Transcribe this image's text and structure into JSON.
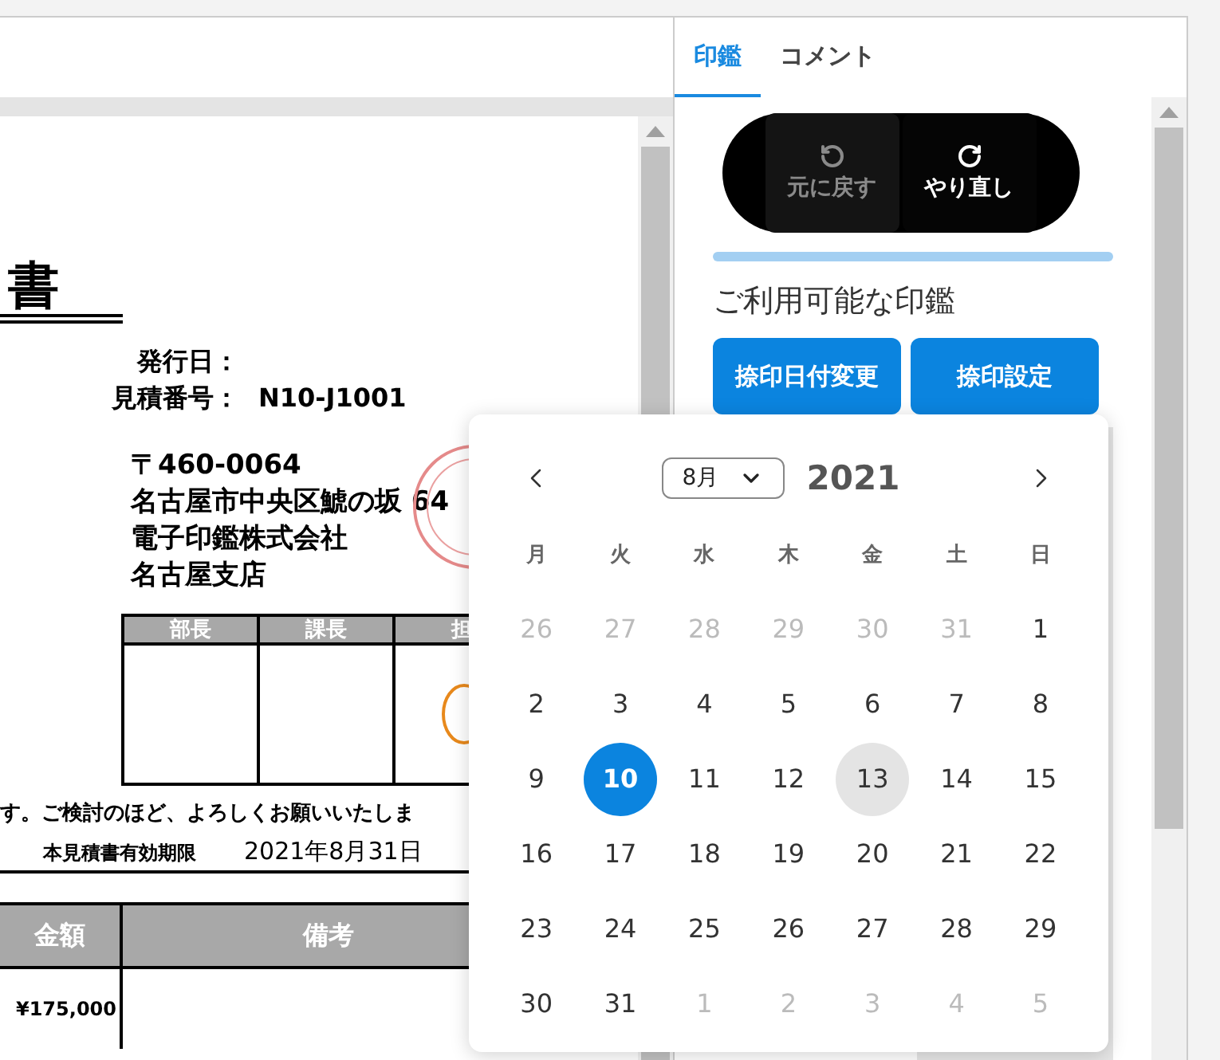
{
  "document": {
    "title": "書",
    "issue_date_label": "発行日：",
    "estimate_label": "見積番号：",
    "estimate_number": "N10-J1001",
    "address": [
      "〒460-0064",
      "名古屋市中央区鯱の坂 64",
      "電子印鑑株式会社",
      "名古屋支店"
    ],
    "approvals": [
      "部長",
      "課長",
      "担"
    ],
    "note": "す。ご検討のほど、よろしくお願いいたしま",
    "validity_label": "本見積書有効期限",
    "validity_date": "2021年8月31日",
    "columns": [
      "金額",
      "備考"
    ],
    "amount": "¥175,000"
  },
  "panel": {
    "tabs": [
      {
        "label": "印鑑",
        "selected": true
      },
      {
        "label": "コメント",
        "selected": false
      }
    ],
    "undo": {
      "label": "元に戻す",
      "disabled": true
    },
    "redo": {
      "label": "やり直し",
      "disabled": false
    },
    "heading": "ご利用可能な印鑑",
    "buttons": [
      "捺印日付変更",
      "捺印設定"
    ]
  },
  "calendar": {
    "month": "8月",
    "year": "2021",
    "weekdays": [
      "月",
      "火",
      "水",
      "木",
      "金",
      "土",
      "日"
    ],
    "weeks": [
      [
        {
          "day": "26",
          "outside": true,
          "selected": false,
          "highlighted": false
        },
        {
          "day": "27",
          "outside": true,
          "selected": false,
          "highlighted": false
        },
        {
          "day": "28",
          "outside": true,
          "selected": false,
          "highlighted": false
        },
        {
          "day": "29",
          "outside": true,
          "selected": false,
          "highlighted": false
        },
        {
          "day": "30",
          "outside": true,
          "selected": false,
          "highlighted": false
        },
        {
          "day": "31",
          "outside": true,
          "selected": false,
          "highlighted": false
        },
        {
          "day": "1",
          "outside": false,
          "selected": false,
          "highlighted": false
        }
      ],
      [
        {
          "day": "2",
          "outside": false,
          "selected": false,
          "highlighted": false
        },
        {
          "day": "3",
          "outside": false,
          "selected": false,
          "highlighted": false
        },
        {
          "day": "4",
          "outside": false,
          "selected": false,
          "highlighted": false
        },
        {
          "day": "5",
          "outside": false,
          "selected": false,
          "highlighted": false
        },
        {
          "day": "6",
          "outside": false,
          "selected": false,
          "highlighted": false
        },
        {
          "day": "7",
          "outside": false,
          "selected": false,
          "highlighted": false
        },
        {
          "day": "8",
          "outside": false,
          "selected": false,
          "highlighted": false
        }
      ],
      [
        {
          "day": "9",
          "outside": false,
          "selected": false,
          "highlighted": false
        },
        {
          "day": "10",
          "outside": false,
          "selected": true,
          "highlighted": false
        },
        {
          "day": "11",
          "outside": false,
          "selected": false,
          "highlighted": false
        },
        {
          "day": "12",
          "outside": false,
          "selected": false,
          "highlighted": false
        },
        {
          "day": "13",
          "outside": false,
          "selected": false,
          "highlighted": true
        },
        {
          "day": "14",
          "outside": false,
          "selected": false,
          "highlighted": false
        },
        {
          "day": "15",
          "outside": false,
          "selected": false,
          "highlighted": false
        }
      ],
      [
        {
          "day": "16",
          "outside": false,
          "selected": false,
          "highlighted": false
        },
        {
          "day": "17",
          "outside": false,
          "selected": false,
          "highlighted": false
        },
        {
          "day": "18",
          "outside": false,
          "selected": false,
          "highlighted": false
        },
        {
          "day": "19",
          "outside": false,
          "selected": false,
          "highlighted": false
        },
        {
          "day": "20",
          "outside": false,
          "selected": false,
          "highlighted": false
        },
        {
          "day": "21",
          "outside": false,
          "selected": false,
          "highlighted": false
        },
        {
          "day": "22",
          "outside": false,
          "selected": false,
          "highlighted": false
        }
      ],
      [
        {
          "day": "23",
          "outside": false,
          "selected": false,
          "highlighted": false
        },
        {
          "day": "24",
          "outside": false,
          "selected": false,
          "highlighted": false
        },
        {
          "day": "25",
          "outside": false,
          "selected": false,
          "highlighted": false
        },
        {
          "day": "26",
          "outside": false,
          "selected": false,
          "highlighted": false
        },
        {
          "day": "27",
          "outside": false,
          "selected": false,
          "highlighted": false
        },
        {
          "day": "28",
          "outside": false,
          "selected": false,
          "highlighted": false
        },
        {
          "day": "29",
          "outside": false,
          "selected": false,
          "highlighted": false
        }
      ],
      [
        {
          "day": "30",
          "outside": false,
          "selected": false,
          "highlighted": false
        },
        {
          "day": "31",
          "outside": false,
          "selected": false,
          "highlighted": false
        },
        {
          "day": "1",
          "outside": true,
          "selected": false,
          "highlighted": false
        },
        {
          "day": "2",
          "outside": true,
          "selected": false,
          "highlighted": false
        },
        {
          "day": "3",
          "outside": true,
          "selected": false,
          "highlighted": false
        },
        {
          "day": "4",
          "outside": true,
          "selected": false,
          "highlighted": false
        },
        {
          "day": "5",
          "outside": true,
          "selected": false,
          "highlighted": false
        }
      ]
    ]
  }
}
